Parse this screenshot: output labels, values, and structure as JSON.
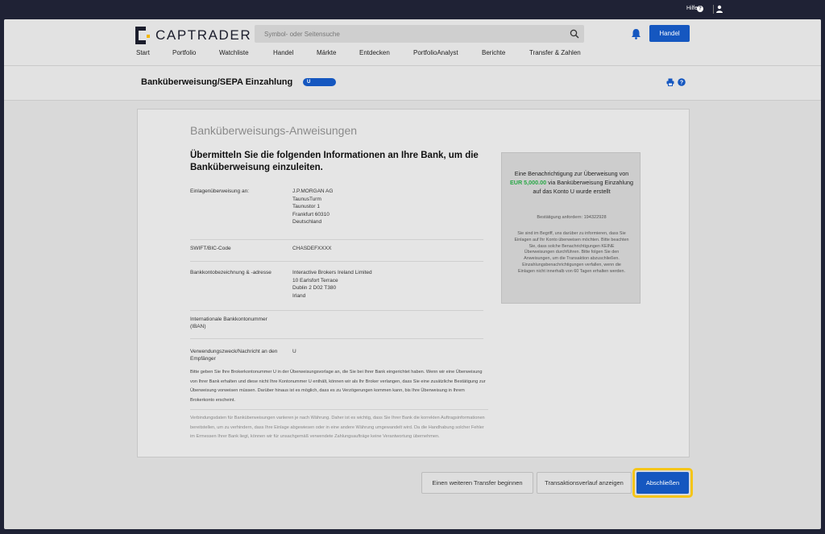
{
  "topbar": {
    "help_label": "Hilfe",
    "help_badge": "?"
  },
  "header": {
    "logo_text": "CAPTRADER",
    "search_placeholder": "Symbol- oder Seitensuche",
    "trade_button": "Handel"
  },
  "nav": [
    "Start",
    "Portfolio",
    "Watchliste",
    "Handel",
    "Märkte",
    "Entdecken",
    "PortfolioAnalyst",
    "Berichte",
    "Transfer & Zahlen"
  ],
  "page": {
    "title": "Banküberweisung/SEPA Einzahlung",
    "account_pill": "U"
  },
  "instructions": {
    "heading": "Banküberweisungs-Anweisungen",
    "lead": "Übermitteln Sie die folgenden Informationen an Ihre Bank, um die Banküberweisung einzuleiten.",
    "rows": [
      {
        "label": "Einlagenüberweisung an:",
        "value": "J.P.MORGAN AG\nTaunusTurm\nTaunustor 1\nFrankfurt 60310\nDeutschland"
      },
      {
        "label": "SWIFT/BIC-Code",
        "value": "CHASDEFXXXX"
      },
      {
        "label": "Bankkontobezeichnung & -adresse",
        "value": "Interactive Brokers Ireland Limited\n10 Earlsfort Terrace\nDublin 2 D02 T380\nIrland"
      },
      {
        "label": "Internationale Bankkontonummer (IBAN)",
        "value": ""
      },
      {
        "label": "Verwendungszweck/Nachricht an den Empfänger",
        "value": "U"
      }
    ],
    "note1": "Bitte geben Sie Ihre Brokerkontonummer U          in der Überweisungsvorlage an, die Sie bei Ihrer Bank eingerichtet haben. Wenn wir eine Überweisung von Ihrer Bank erhalten und diese nicht Ihre Kontonummer U          enthält, können wir als Ihr Broker verlangen, dass Sie eine zusätzliche Bestätigung zur Überweisung vorweisen müssen. Darüber hinaus ist es möglich, dass es zu Verzögerungen kommen kann, bis Ihre Überweisung in Ihrem Brokerkonto erscheint.",
    "note2": "Verbindungsdaten für Banküberweisungen variieren je nach Währung. Daher ist es wichtig, dass Sie Ihrer Bank die korrekten Auftragsinformationen bereitstellen, um zu verhindern, dass Ihre Einlage abgewiesen oder in eine andere Währung umgewandelt wird. Da die Handhabung solcher Fehler im Ermessen Ihrer Bank liegt, können wir für unsachgemäß verwendete Zahlungsaufträge keine Verantwortung übernehmen."
  },
  "notification": {
    "line_before": "Eine Benachrichtigung zur Überweisung von",
    "amount": "EUR 5,000.00",
    "line_after": "via Banküberweisung Einzahlung auf das Konto U          wurde erstellt",
    "confirmation": "Bestätigung anfordern: 194322928",
    "info": "Sie sind im Begriff, uns darüber zu informieren, dass Sie Einlagen auf Ihr Konto überweisen möchten. Bitte beachten Sie, dass solche Benachrichtigungen KEINE Überweisungen durchführen. Bitte folgen Sie den Anweisungen, um die Transaktion abzuschließen. Einzahlungsbenachrichtigungen verfallen, wenn die Einlagen nicht innerhalb von 60 Tagen erhalten werden."
  },
  "actions": {
    "another": "Einen weiteren Transfer beginnen",
    "history": "Transaktionsverlauf anzeigen",
    "finish": "Abschließen"
  },
  "colors": {
    "brand_blue": "#1557c0",
    "focus_yellow": "#f5c518",
    "amount_green": "#27a745"
  }
}
